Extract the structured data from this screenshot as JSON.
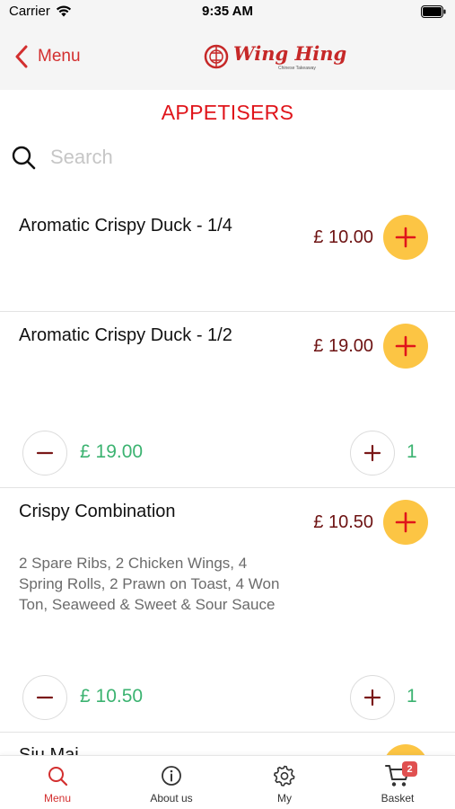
{
  "status_bar": {
    "carrier": "Carrier",
    "time": "9:35 AM"
  },
  "nav": {
    "back_label": "Menu",
    "logo_text": "Wing Hing",
    "logo_subtitle": "Chinese Takeaway"
  },
  "section_title": "APPETISERS",
  "search": {
    "placeholder": "Search",
    "value": ""
  },
  "items": [
    {
      "name": "Aromatic Crispy Duck - 1/4",
      "price": "£ 10.00"
    },
    {
      "name": "Aromatic Crispy Duck - 1/2",
      "price": "£ 19.00",
      "line_total": "£ 19.00",
      "quantity": "1"
    },
    {
      "name": "Crispy Combination",
      "price": "£ 10.50",
      "description": "2 Spare Ribs, 2 Chicken Wings, 4 Spring Rolls, 2 Prawn on Toast, 4 Won Ton, Seaweed & Sweet & Sour Sauce",
      "line_total": "£ 10.50",
      "quantity": "1"
    },
    {
      "name": "Siu Mai"
    }
  ],
  "tabs": [
    {
      "label": "Menu",
      "icon": "search-icon",
      "active": true
    },
    {
      "label": "About us",
      "icon": "info-icon",
      "active": false
    },
    {
      "label": "My",
      "icon": "gear-icon",
      "active": false
    },
    {
      "label": "Basket",
      "icon": "cart-icon",
      "active": false,
      "badge": "2"
    }
  ],
  "colors": {
    "accent": "#e0151b",
    "price": "#6d1212",
    "add_button": "#fcc544",
    "qty_text": "#3cb371",
    "badge": "#e05050"
  }
}
